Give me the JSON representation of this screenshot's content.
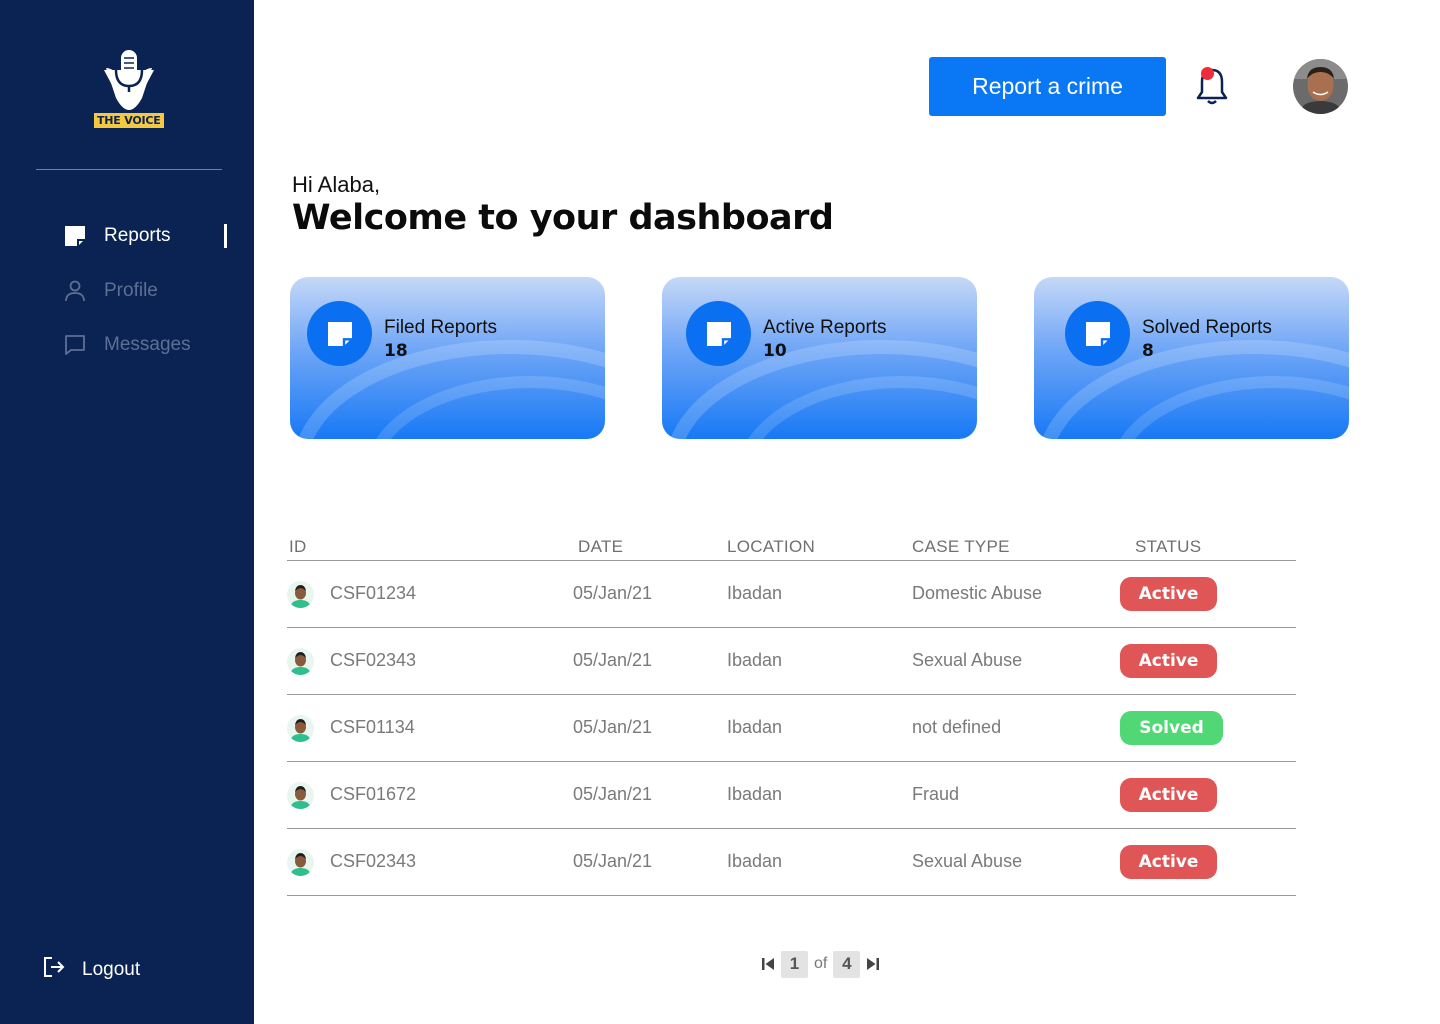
{
  "brand": {
    "logo_text": "THE VOICE"
  },
  "sidebar": {
    "items": [
      {
        "label": "Reports",
        "icon": "note-icon",
        "active": true
      },
      {
        "label": "Profile",
        "icon": "user-icon",
        "active": false
      },
      {
        "label": "Messages",
        "icon": "message-icon",
        "active": false
      }
    ],
    "logout_label": "Logout"
  },
  "header": {
    "report_button": "Report a crime",
    "notification_icon": "bell-icon",
    "has_unread_notification": true
  },
  "greeting": {
    "hello": "Hi Alaba,",
    "title": "Welcome to your dashboard"
  },
  "cards": [
    {
      "label": "Filed Reports",
      "value": "18",
      "icon": "note-icon"
    },
    {
      "label": "Active Reports",
      "value": "10",
      "icon": "note-icon"
    },
    {
      "label": "Solved Reports",
      "value": "8",
      "icon": "note-icon"
    }
  ],
  "table": {
    "columns": [
      "ID",
      "DATE",
      "LOCATION",
      "CASE TYPE",
      "STATUS"
    ],
    "rows": [
      {
        "id": "CSF01234",
        "date": "05/Jan/21",
        "location": "Ibadan",
        "case_type": "Domestic Abuse",
        "status": "Active"
      },
      {
        "id": "CSF02343",
        "date": "05/Jan/21",
        "location": "Ibadan",
        "case_type": "Sexual Abuse",
        "status": "Active"
      },
      {
        "id": "CSF01134",
        "date": "05/Jan/21",
        "location": "Ibadan",
        "case_type": "not defined",
        "status": "Solved"
      },
      {
        "id": "CSF01672",
        "date": "05/Jan/21",
        "location": "Ibadan",
        "case_type": "Fraud",
        "status": "Active"
      },
      {
        "id": "CSF02343",
        "date": "05/Jan/21",
        "location": "Ibadan",
        "case_type": "Sexual Abuse",
        "status": "Active"
      }
    ]
  },
  "pagination": {
    "current": "1",
    "of_label": "of",
    "total": "4"
  },
  "colors": {
    "sidebar": "#0b2352",
    "accent": "#0a78f5",
    "active_badge": "#e05555",
    "solved_badge": "#4fd873",
    "logo_badge": "#f5c842"
  }
}
